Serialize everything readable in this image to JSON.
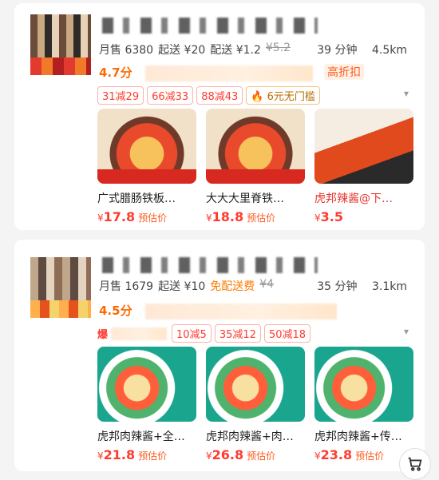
{
  "stores": [
    {
      "monthly_sales": "月售 6380",
      "min_order": "起送 ¥20",
      "delivery_fee": "配送 ¥1.2",
      "original_fee": "¥5.2",
      "eta": "39 分钟",
      "distance": "4.5km",
      "rating": "4.7分",
      "highlight": "高折扣",
      "coupons": [
        "31减29",
        "66减33",
        "88减43",
        "6元无门槛"
      ],
      "products": [
        {
          "name": "广式腊肠铁板…",
          "price": "17.8",
          "est": "预估价"
        },
        {
          "name": "大大大里脊铁…",
          "price": "18.8",
          "est": "预估价"
        },
        {
          "name": "虎邦辣酱@下…",
          "price": "3.5",
          "est": ""
        }
      ]
    },
    {
      "monthly_sales": "月售 1679",
      "min_order": "起送 ¥10",
      "delivery_fee": "免配送费",
      "original_fee": "¥4",
      "eta": "35 分钟",
      "distance": "3.1km",
      "rating": "4.5分",
      "burst": "爆",
      "coupons": [
        "10减5",
        "35减12",
        "50减18"
      ],
      "products": [
        {
          "name": "虎邦肉辣酱+全…",
          "price": "21.8",
          "est": "预估价"
        },
        {
          "name": "虎邦肉辣酱+肉…",
          "price": "26.8",
          "est": "预估价"
        },
        {
          "name": "虎邦肉辣酱+传…",
          "price": "23.8",
          "est": "预估价"
        }
      ]
    }
  ],
  "currency": "¥",
  "colors": {
    "accent": "#ff3b2f",
    "orange": "#ff6a00"
  },
  "icons": {
    "chevron": "chevron-down-icon",
    "cart": "cart-icon",
    "flame": "flame-icon"
  }
}
